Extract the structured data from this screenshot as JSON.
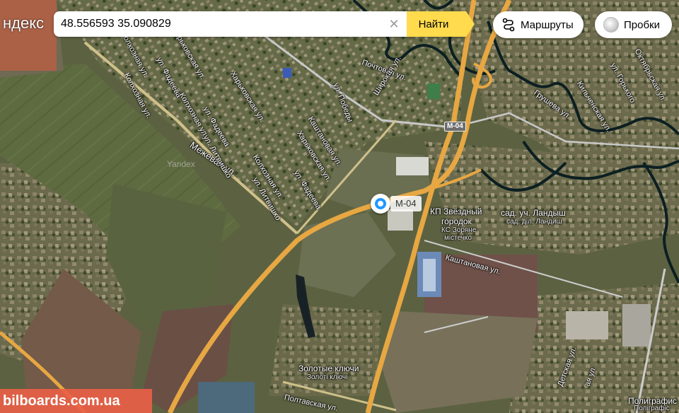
{
  "logo": {
    "text": "ндекс"
  },
  "search": {
    "value": "48.556593 35.090829",
    "clear_icon": "close-icon",
    "button_label": "Найти"
  },
  "controls": {
    "routes_label": "Маршруты",
    "routes_icon": "route-icon",
    "traffic_label": "Пробки",
    "traffic_icon": "traffic-light-icon"
  },
  "marker": {
    "label": "М-04",
    "color": "#1e98ff"
  },
  "road_shield": "М-04",
  "streets": {
    "mezhevaya": "Межевая ул.",
    "pochtovaya": "Почтовая ул.",
    "pobedy": "ул. Победы",
    "shirokaya": "Широкая ул.",
    "kashtanovaya_upper": "Каштановая ул.",
    "kashtanovaya_lower": "Каштановая ул.",
    "kharkovskaya_1": "Харьковская ул.",
    "kharkovskaya_2": "Харьковская ул.",
    "kharkovskaya_3": "Харьковская ул.",
    "fadeeva_1": "ул. Фадеева",
    "fadeeva_2": "ул. Фадеева",
    "fadeeva_3": "ул. Фадеева",
    "kolkhoznaya_1": "Колхозная ул.",
    "kolkhoznaya_2": "Колхозная ул.",
    "kolkhoznaya_3": "Колхозная ул.",
    "litvishko_1": "ул. Литвишко",
    "litvishko_2": "ул. Литвишко",
    "gorkogo": "ул. Горького",
    "oktyabrskaya": "Октябрьская ул.",
    "kilchenskaya": "Кильченская ул.",
    "grusheva": "Грушева ул.",
    "poltavskaya": "Полтавская ул.",
    "kolkhoznaya_top": "Колхозная ул.",
    "detskaya": "ая ул.",
    "tikhaya": "Детская ул."
  },
  "places": {
    "zvezdny": "КП Звёздный",
    "gorodok": "городок",
    "zorane": "КС Зоряне",
    "mistechko": "містечко",
    "landysh": "сад. уч. Ландыш",
    "landysh_ua": "сад. діл. Ландиш",
    "zolotye": "Золотые ключи",
    "zoloti": "Золоті ключі",
    "poligraf": "Полиграфис",
    "poligraf_ua": "Поліграфіс"
  },
  "watermark": "bilboards.com.ua",
  "imagery_watermark": "Yandex",
  "colors": {
    "road": "#e7a742",
    "road_secondary": "#cfc08a",
    "river": "#0c1f22",
    "search_button": "#ffdb4d",
    "marker": "#1e98ff",
    "watermark_bg": "#eb5f46"
  }
}
